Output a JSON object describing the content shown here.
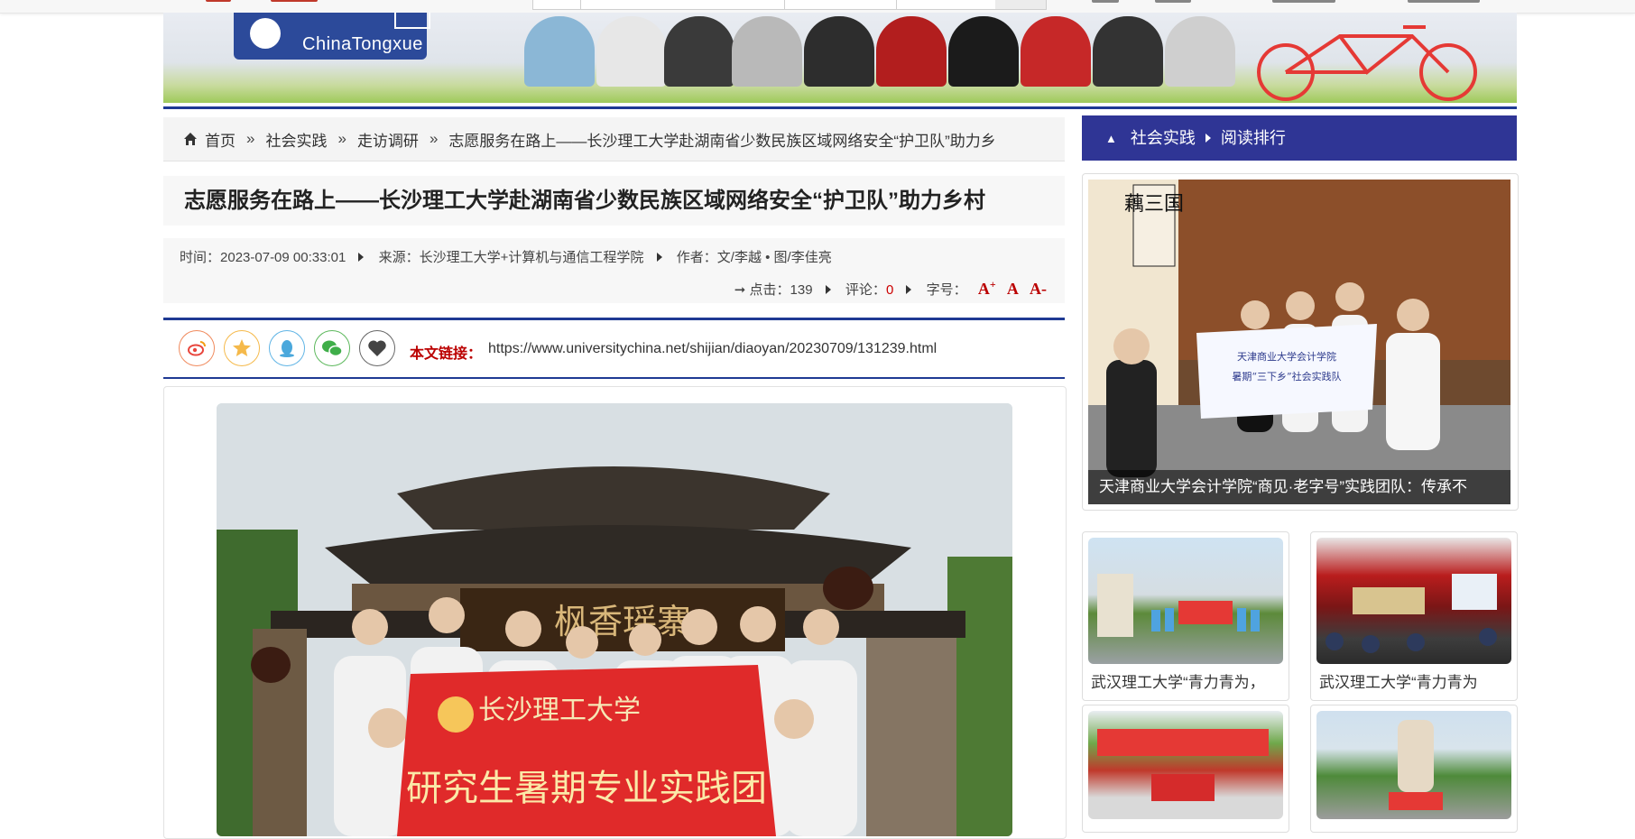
{
  "header": {
    "logo_text": "ChinaTongxue"
  },
  "breadcrumb": {
    "items": [
      "首页",
      "社会实践",
      "走访调研",
      "志愿服务在路上——长沙理工大学赴湖南省少数民族区域网络安全“护卫队”助力乡"
    ],
    "separator": "»"
  },
  "article": {
    "title": "志愿服务在路上——长沙理工大学赴湖南省少数民族区域网络安全“护卫队”助力乡村",
    "time_label": "时间：",
    "time": "2023-07-09 00:33:01",
    "source_label": "来源：",
    "source": "长沙理工大学+计算机与通信工程学院",
    "author_label": "作者：",
    "author": "文/李越 • 图/李佳亮",
    "arrow": "➞",
    "clicks_label": "点击：",
    "clicks": "139",
    "comments_label": "评论：",
    "comments": "0",
    "fontsize_label": "字号：",
    "font_plus": "A",
    "font_plus_sup": "+",
    "font_normal": "A",
    "font_minus": "A-",
    "link_label": "本文链接：",
    "link_url": "https://www.universitychina.net/shijian/diaoyan/20230709/131239.html",
    "photo_sign": "枫香瑶寨",
    "banner_text_1": "长沙理工大学",
    "banner_text_2": "研究生暑期专业实践团"
  },
  "share_icons": [
    "weibo-icon",
    "qzone-icon",
    "qq-icon",
    "wechat-icon",
    "favorite-icon"
  ],
  "sidebar": {
    "head_label": "社会实践",
    "head_tab": "阅读排行",
    "feature_caption": "天津商业大学会计学院“商见·老字号”实践团队：传承不",
    "feature_sign": "藕三国",
    "feature_banner_1": "天津商业大学会计学院",
    "feature_banner_2": "暑期“三下乡”社会实践队",
    "cards": [
      {
        "caption": "武汉理工大学“青力青为，"
      },
      {
        "caption": "武汉理工大学“青力青为"
      }
    ]
  },
  "colors": {
    "accent_blue": "#2f3595",
    "rule_blue": "#1f3a93",
    "link_red": "#b00000"
  }
}
